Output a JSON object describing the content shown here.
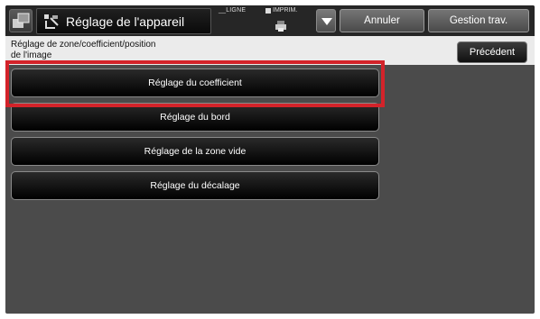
{
  "window": {
    "title": "Réglage de l'appareil",
    "status_ligne": "LIGNE",
    "status_imprim": "IMPRIM."
  },
  "toolbar": {
    "annuler_label": "Annuler",
    "gestion_label": "Gestion trav."
  },
  "subheader": {
    "crumb_line1": "Réglage de zone/coefficient/position",
    "crumb_line2": "de l'image",
    "precedent_label": "Précédent"
  },
  "menu": {
    "items": [
      {
        "label": "Réglage du coefficient"
      },
      {
        "label": "Réglage du bord"
      },
      {
        "label": "Réglage de la zone vide"
      },
      {
        "label": "Réglage du décalage"
      }
    ]
  },
  "colors": {
    "highlight": "#d3232a",
    "panel": "#4b4b4b",
    "topbar": "#262626"
  },
  "icons": [
    "settings-app-icon",
    "device-adjust-icon",
    "printer-icon",
    "dropdown-arrow-icon"
  ]
}
